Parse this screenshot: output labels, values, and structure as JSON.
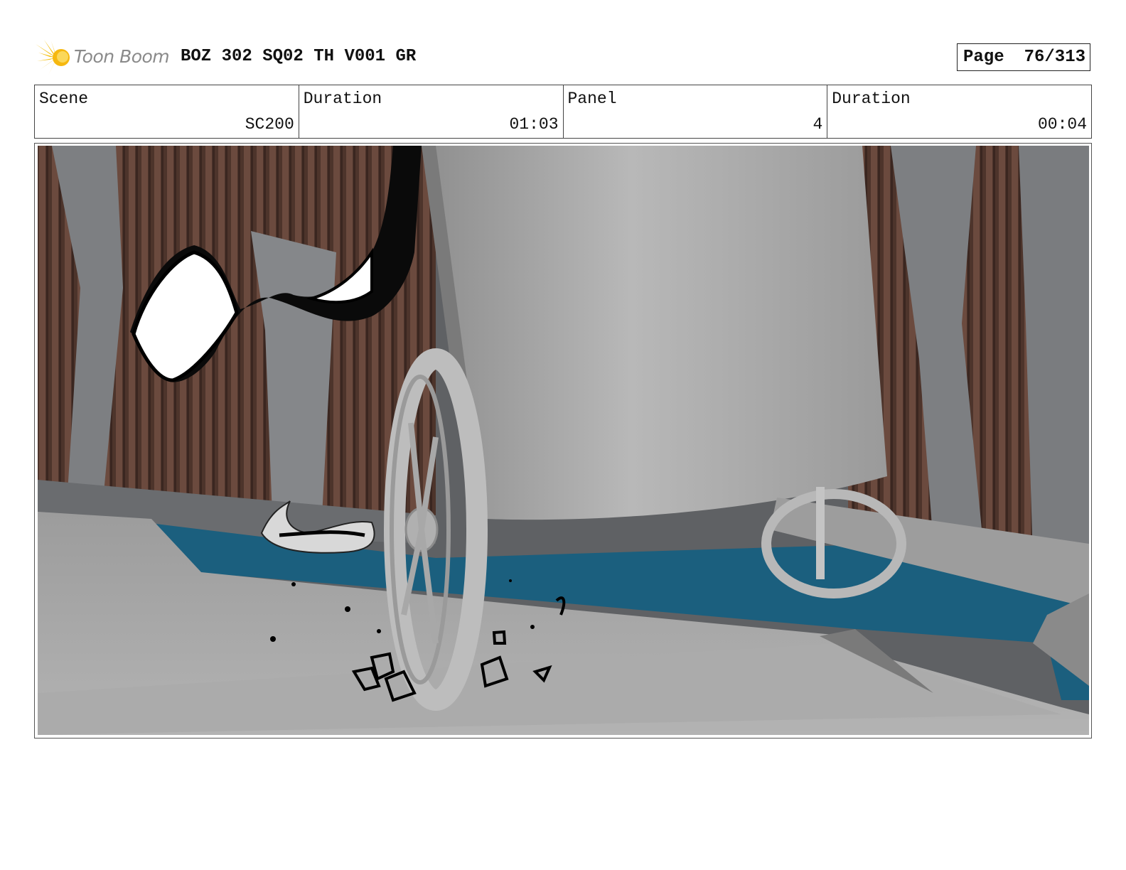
{
  "logo": {
    "brand_text": "Toon Boom",
    "icon": "starburst-icon"
  },
  "header": {
    "title": "BOZ 302 SQ02 TH V001 GR",
    "page_label": "Page",
    "page_value": "76/313"
  },
  "info": {
    "scene_label": "Scene",
    "scene_value": "SC200",
    "scene_duration_label": "Duration",
    "scene_duration_value": "01:03",
    "panel_label": "Panel",
    "panel_value": "4",
    "panel_duration_label": "Duration",
    "panel_duration_value": "00:04"
  },
  "colors": {
    "water": "#1b5f7e",
    "rock_columns": "#5a3d33",
    "cave_rock": "#6e7073",
    "ground": "#a6a6a6",
    "wagon": "#b0b0b0",
    "logo_yellow": "#f4c21a"
  }
}
